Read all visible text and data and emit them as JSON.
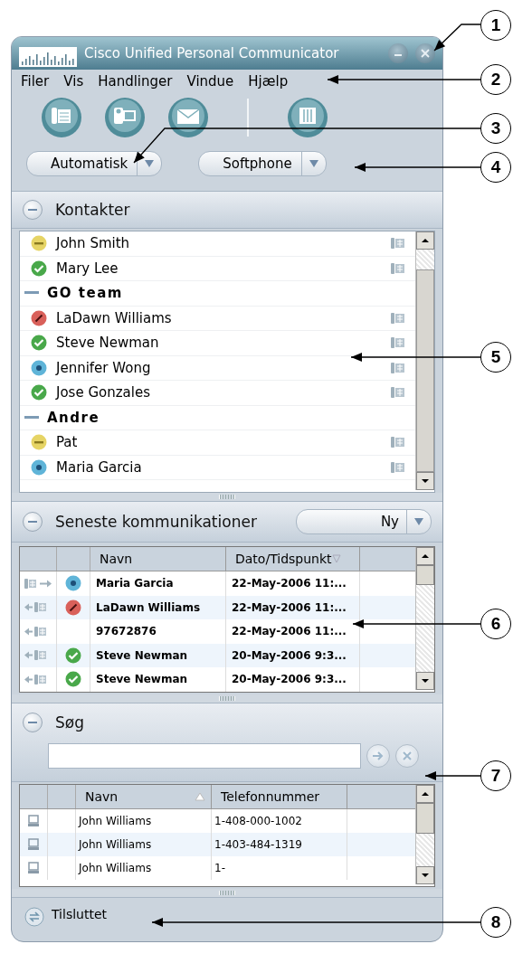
{
  "window": {
    "title": "Cisco Unified Personal Communicator"
  },
  "menu": [
    "Filer",
    "Vis",
    "Handlinger",
    "Vindue",
    "Hjælp"
  ],
  "status_dropdown": {
    "value": "Automatisk"
  },
  "device_dropdown": {
    "value": "Softphone"
  },
  "contacts": {
    "title": "Kontakter",
    "expanded": true,
    "items": [
      {
        "kind": "contact",
        "name": "John Smith",
        "color": "#e6d465"
      },
      {
        "kind": "contact",
        "name": "Mary Lee",
        "color": "#49a84a"
      },
      {
        "kind": "group",
        "name": "GO team",
        "expanded": true,
        "children": [
          {
            "kind": "contact",
            "name": "LaDawn Williams",
            "color": "#d9605a"
          },
          {
            "kind": "contact",
            "name": "Steve Newman",
            "color": "#49a84a"
          },
          {
            "kind": "contact",
            "name": "Jennifer Wong",
            "color": "#5fb4d8"
          },
          {
            "kind": "contact",
            "name": "Jose Gonzales",
            "color": "#49a84a"
          }
        ]
      },
      {
        "kind": "group",
        "name": "Andre",
        "expanded": true,
        "children": [
          {
            "kind": "contact",
            "name": "Pat",
            "color": "#e6d465"
          },
          {
            "kind": "contact",
            "name": "Maria Garcia",
            "color": "#5fb4d8"
          }
        ]
      }
    ]
  },
  "recent": {
    "title": "Seneste kommunikationer",
    "expanded": true,
    "filter": "Ny",
    "columns": [
      {
        "label": "Navn",
        "sorted": false
      },
      {
        "label": "Dato/Tidspunkt",
        "sorted": true
      }
    ],
    "rows": [
      {
        "kind": "outgoing",
        "color": "#5fb4d8",
        "name": "Maria Garcia",
        "time": "22-May-2006 11:..."
      },
      {
        "kind": "incoming",
        "color": "#d9605a",
        "name": "LaDawn Williams",
        "time": "22-May-2006 11:..."
      },
      {
        "kind": "incoming",
        "name": "97672876",
        "time": "22-May-2006 11:..."
      },
      {
        "kind": "incoming",
        "color": "#49a84a",
        "name": "Steve Newman",
        "time": "20-May-2006 9:3..."
      },
      {
        "kind": "incoming",
        "color": "#49a84a",
        "name": "Steve Newman",
        "time": "20-May-2006 9:3..."
      }
    ]
  },
  "search": {
    "title": "Søg",
    "expanded": true,
    "columns": [
      {
        "label": "Navn",
        "sorted": true
      },
      {
        "label": "Telefonnummer",
        "sorted": false
      }
    ],
    "rows": [
      {
        "name": "John Williams",
        "phone": "1-408-000-1002"
      },
      {
        "name": "John Williams",
        "phone": "1-403-484-1319"
      },
      {
        "name": "John Williams",
        "phone": "1-"
      }
    ]
  },
  "status_bar": {
    "text": "Tilsluttet"
  },
  "callouts": [
    {
      "number": "1"
    },
    {
      "number": "2"
    },
    {
      "number": "3"
    },
    {
      "number": "4"
    },
    {
      "number": "5"
    },
    {
      "number": "6"
    },
    {
      "number": "7"
    },
    {
      "number": "8"
    }
  ]
}
